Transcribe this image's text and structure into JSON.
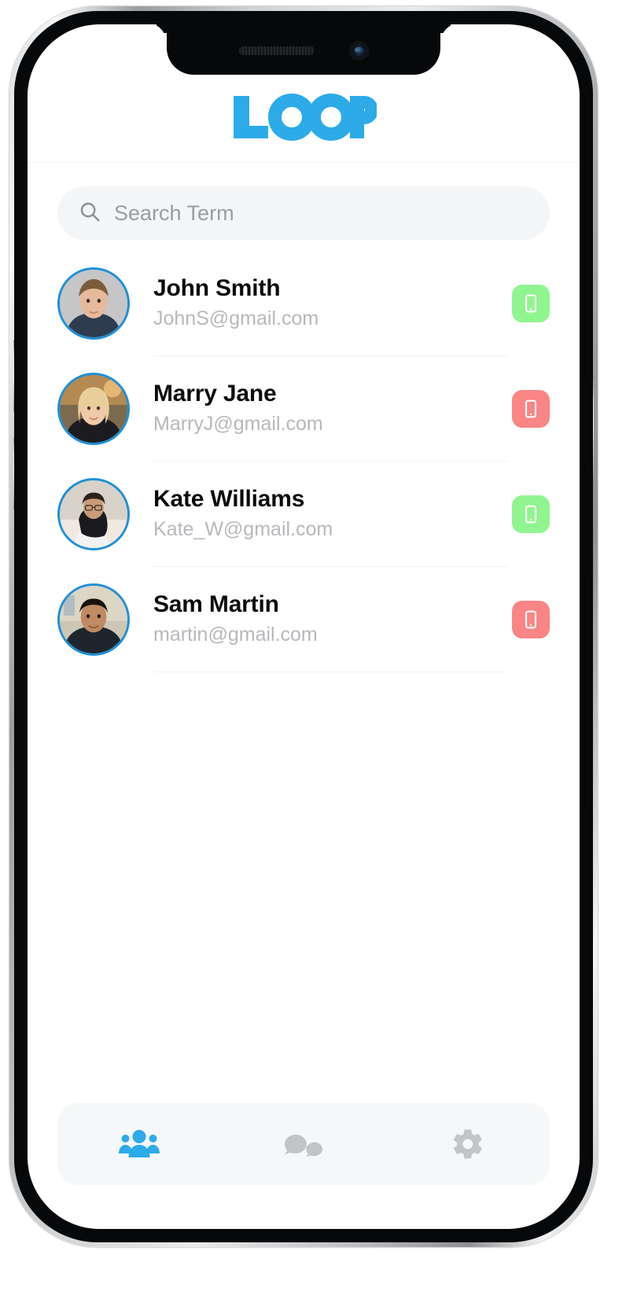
{
  "device": {
    "type": "iphone-mockup",
    "notch_elements": [
      "speaker-grille",
      "front-camera"
    ],
    "side_buttons": [
      "mute-switch",
      "volume-up",
      "volume-down",
      "power"
    ]
  },
  "app": {
    "logo_text": "LOOP",
    "brand_color": "#2cabe8"
  },
  "search": {
    "placeholder": "Search Term",
    "value": "",
    "icon": "search-icon"
  },
  "contacts": [
    {
      "name": "John Smith",
      "email": "JohnS@gmail.com",
      "status": "online",
      "status_color": "#90f58f",
      "status_icon": "smartphone-icon",
      "avatar_icon": "avatar-photo"
    },
    {
      "name": "Marry Jane",
      "email": "MarryJ@gmail.com",
      "status": "offline",
      "status_color": "#fa8585",
      "status_icon": "smartphone-icon",
      "avatar_icon": "avatar-photo"
    },
    {
      "name": "Kate Williams",
      "email": "Kate_W@gmail.com",
      "status": "online",
      "status_color": "#90f58f",
      "status_icon": "smartphone-icon",
      "avatar_icon": "avatar-photo"
    },
    {
      "name": "Sam Martin",
      "email": "martin@gmail.com",
      "status": "offline",
      "status_color": "#fa8585",
      "status_icon": "smartphone-icon",
      "avatar_icon": "avatar-photo"
    }
  ],
  "tabbar": {
    "items": [
      {
        "id": "contacts",
        "icon": "people-group-icon",
        "active": true,
        "color": "#2cabe8"
      },
      {
        "id": "chats",
        "icon": "chat-bubbles-icon",
        "active": false,
        "color": "#c2c4c7"
      },
      {
        "id": "settings",
        "icon": "gear-icon",
        "active": false,
        "color": "#c2c4c7"
      }
    ]
  },
  "colors": {
    "accent": "#2cabe8",
    "avatar_ring": "#1e90d8",
    "online": "#90f58f",
    "offline": "#fa8585",
    "search_bg": "#f4f5f7",
    "tabbar_bg": "#f6f7f8",
    "name_text": "#0b0b0d",
    "email_text": "#b6b8bc",
    "divider": "#f0f1f3"
  }
}
